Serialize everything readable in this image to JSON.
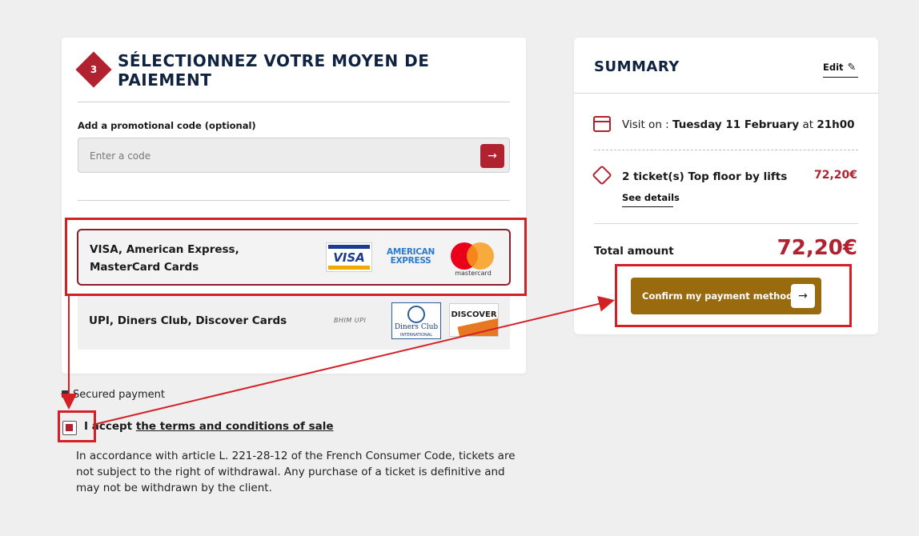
{
  "step": {
    "number": "3",
    "title": "SÉLECTIONNEZ VOTRE MOYEN DE PAIEMENT"
  },
  "promo": {
    "label": "Add a promotional code (optional)",
    "placeholder": "Enter a code",
    "submit_icon": "arrow-right-icon"
  },
  "payment_options": [
    {
      "label": "VISA, American Express, MasterCard Cards",
      "logos": [
        "VISA",
        "AMERICAN EXPRESS",
        "mastercard"
      ],
      "selected": true
    },
    {
      "label": "UPI, Diners Club, Discover Cards",
      "logos": [
        "BHIM UPI",
        "Diners Club",
        "INTERNATIONAL",
        "DISCOVER"
      ],
      "selected": false
    }
  ],
  "secured_text": "Secured payment",
  "terms": {
    "prefix": "I accept ",
    "link_text": "the terms and conditions of sale",
    "checked": true
  },
  "legal_text": "In accordance with article L. 221-28-12 of the French Consumer Code, tickets are not subject to the right of withdrawal. Any purchase of a ticket is definitive and may not be withdrawn by the client.",
  "summary": {
    "title": "SUMMARY",
    "edit_label": "Edit",
    "visit_prefix": "Visit on : ",
    "visit_date": "Tuesday 11 February",
    "visit_at": " at ",
    "visit_time": "21h00",
    "ticket_label": "2 ticket(s) Top floor by lifts",
    "ticket_price": "72,20€",
    "details_label": "See details",
    "total_label": "Total amount",
    "total_value": "72,20€",
    "confirm_label": "Confirm my payment method"
  },
  "colors": {
    "accent": "#b0222f",
    "navy": "#0f2340",
    "confirm_button": "#9a6a0e",
    "annotation": "#d32027"
  }
}
